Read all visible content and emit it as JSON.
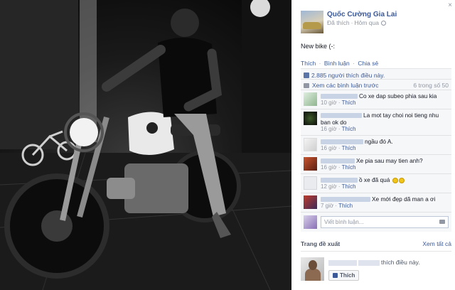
{
  "post": {
    "author": "Quốc Cường Gia Lai",
    "meta_liked": "Đã thích",
    "meta_dot": "·",
    "meta_time": "Hôm qua",
    "caption": "New bike (-:",
    "close": "×"
  },
  "actions": {
    "like": "Thích",
    "comment": "Bình luận",
    "share": "Chia sẻ",
    "dot": "·"
  },
  "likes": {
    "text": "2.885 người thích điều này."
  },
  "previous": {
    "label": "Xem các bình luận trước",
    "count": "6 trong số 50"
  },
  "comments": [
    {
      "text": "Co xe dap subeo phia sau kia",
      "time": "10 giờ",
      "like": "Thích"
    },
    {
      "text": "La mot tay choi noi tieng nhu ban ok do",
      "time": "16 giờ",
      "like": "Thích"
    },
    {
      "text": "ngầu đó A.",
      "time": "16 giờ",
      "like": "Thích"
    },
    {
      "text": "Xe pia sau may tien anh?",
      "time": "16 giờ",
      "like": "Thích"
    },
    {
      "text": "ồ xe đã quá",
      "time": "12 giờ",
      "like": "Thích"
    },
    {
      "text": "Xe mới đẹp dã man a ơi",
      "time": "7 giờ",
      "like": "Thích"
    }
  ],
  "write": {
    "placeholder": "Viết bình luận..."
  },
  "suggest": {
    "title": "Trang đề xuất",
    "see_all": "Xem tất cả",
    "liked_text": "thích điều này.",
    "like_button": "Thích"
  },
  "colors": {
    "link": "#3b5998",
    "meta": "#9197a3",
    "panel_bg": "#ffffff",
    "ufi_bg": "#f6f7f9"
  }
}
